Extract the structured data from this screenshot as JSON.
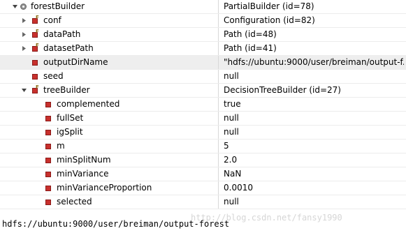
{
  "variables": [
    {
      "name": "forestBuilder",
      "value": "PartialBuilder  (id=78)",
      "icon": "root-object-icon"
    },
    {
      "name": "conf",
      "value": "Configuration  (id=82)",
      "icon": "final-field-icon"
    },
    {
      "name": "dataPath",
      "value": "Path  (id=48)",
      "icon": "final-field-icon"
    },
    {
      "name": "datasetPath",
      "value": "Path  (id=41)",
      "icon": "final-field-icon"
    },
    {
      "name": "outputDirName",
      "value": "\"hdfs://ubuntu:9000/user/breiman/output-f...",
      "icon": "private-field-icon"
    },
    {
      "name": "seed",
      "value": "null",
      "icon": "private-field-icon"
    },
    {
      "name": "treeBuilder",
      "value": "DecisionTreeBuilder  (id=27)",
      "icon": "final-field-icon"
    },
    {
      "name": "complemented",
      "value": "true",
      "icon": "private-field-icon"
    },
    {
      "name": "fullSet",
      "value": "null",
      "icon": "private-field-icon"
    },
    {
      "name": "igSplit",
      "value": "null",
      "icon": "private-field-icon"
    },
    {
      "name": "m",
      "value": "5",
      "icon": "private-field-icon"
    },
    {
      "name": "minSplitNum",
      "value": "2.0",
      "icon": "private-field-icon"
    },
    {
      "name": "minVariance",
      "value": "NaN",
      "icon": "private-field-icon"
    },
    {
      "name": "minVarianceProportion",
      "value": "0.0010",
      "icon": "private-field-icon"
    },
    {
      "name": "selected",
      "value": "null",
      "icon": "private-field-icon"
    }
  ],
  "detail_pane": {
    "text": "hdfs://ubuntu:9000/user/breiman/output-forest"
  },
  "watermark": {
    "text": "http://blog.csdn.net/fansy1990"
  },
  "colors": {
    "selected_row": "#eeeeee",
    "private_icon": "#c8302d",
    "final_marker": "#8a6a12"
  }
}
